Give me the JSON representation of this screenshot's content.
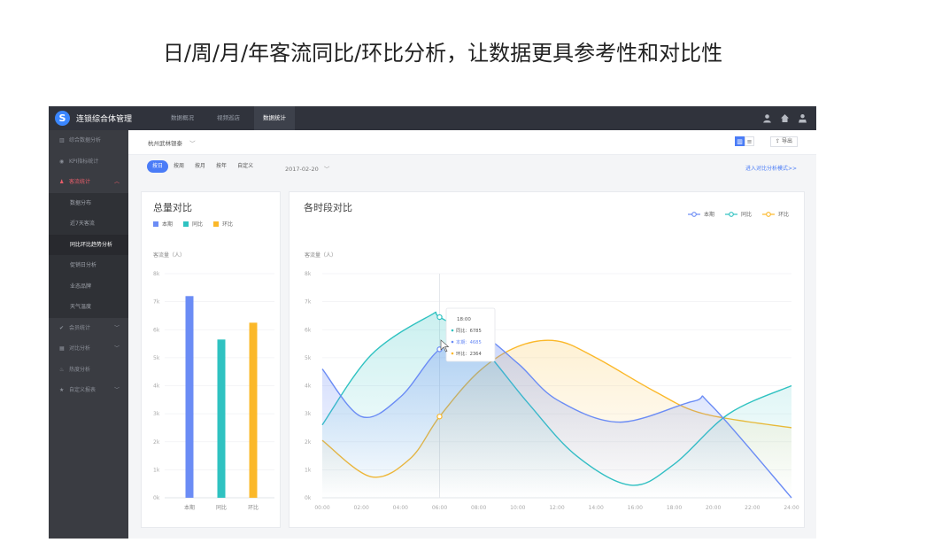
{
  "headline": "日/周/月/年客流同比/环比分析，让数据更具参考性和对比性",
  "app": {
    "logo_glyph": "S",
    "title": "连锁综合体管理",
    "topnav": [
      "数据概况",
      "视频巡店",
      "数据统计"
    ],
    "topnav_active": 2,
    "top_icons": [
      "user-icon",
      "home-icon",
      "download-icon"
    ]
  },
  "sidebar": {
    "items_top": [
      {
        "icon": "bar-chart-icon",
        "glyph": "▥",
        "label": "综合数据分析"
      },
      {
        "icon": "gauge-icon",
        "glyph": "◉",
        "label": "KPI指标统计"
      }
    ],
    "open_group": {
      "icon": "users-icon",
      "glyph": "♟",
      "label": "客流统计",
      "chevron": "︿"
    },
    "sub_items": [
      "数据分布",
      "近7天客流",
      "同比环比趋势分析",
      "促销日分析",
      "业态品牌",
      "天气温度"
    ],
    "sub_active": 2,
    "items_bottom": [
      {
        "icon": "check-icon",
        "glyph": "✔",
        "label": "会员统计",
        "chevron": "﹀"
      },
      {
        "icon": "calendar-icon",
        "glyph": "▦",
        "label": "对比分析",
        "chevron": "﹀"
      },
      {
        "icon": "fire-icon",
        "glyph": "♨",
        "label": "热度分析",
        "chevron": ""
      },
      {
        "icon": "star-icon",
        "glyph": "★",
        "label": "自定义报表",
        "chevron": "﹀"
      }
    ]
  },
  "filterbar": {
    "store": "杭州武林银泰",
    "store_chevron": "﹀",
    "view_chart_glyph": "▥",
    "view_list_glyph": "≡",
    "export_label": "⇪ 导出"
  },
  "periodbar": {
    "tabs": [
      "按日",
      "按周",
      "按月",
      "按年",
      "自定义"
    ],
    "active_tab": 0,
    "date": "2017-02-20",
    "date_chevron": "﹀",
    "compare_link": "进入对比分析模式>>"
  },
  "colors": {
    "current": "#6b8cf5",
    "yoy": "#2fc2c1",
    "mom": "#fbb829"
  },
  "chart_data": [
    {
      "type": "bar",
      "title": "总量对比",
      "ylabel": "客流量（人）",
      "categories": [
        "本期",
        "同比",
        "环比"
      ],
      "legend": [
        "本期",
        "同比",
        "环比"
      ],
      "values": [
        7200,
        5650,
        6250
      ],
      "yticks": [
        "0k",
        "1k",
        "2k",
        "3k",
        "4k",
        "5k",
        "6k",
        "7k",
        "8k"
      ],
      "ylim": [
        0,
        8000
      ]
    },
    {
      "type": "area",
      "title": "各时段对比",
      "ylabel": "客流量（人）",
      "x": [
        "00:00",
        "02:00",
        "04:00",
        "06:00",
        "08:00",
        "10:00",
        "12:00",
        "14:00",
        "16:00",
        "18:00",
        "20:00",
        "22:00",
        "24:00"
      ],
      "yticks": [
        "0k",
        "1k",
        "2k",
        "3k",
        "4k",
        "5k",
        "6k",
        "7k",
        "8k"
      ],
      "ylim": [
        0,
        8000
      ],
      "series": [
        {
          "name": "本期",
          "values": [
            4600,
            2900,
            3600,
            5300,
            5800,
            4800,
            3500,
            2700,
            3450,
            3300,
            null,
            null,
            0
          ],
          "hours": [
            0,
            2,
            4,
            6,
            8,
            10,
            12,
            15.2,
            19,
            19.9,
            null,
            null,
            24
          ]
        },
        {
          "name": "同比",
          "values": [
            2600,
            5100,
            6500,
            6450,
            5500,
            3400,
            1500,
            450,
            1200,
            3000,
            4000
          ],
          "hours": [
            0,
            2.5,
            5.5,
            6,
            8,
            10.5,
            13,
            15.8,
            18,
            20.8,
            24
          ]
        },
        {
          "name": "环比",
          "values": [
            2050,
            750,
            1400,
            2900,
            4500,
            5400,
            5600,
            5000,
            3800,
            3000,
            2500
          ],
          "hours": [
            0,
            2.5,
            4.5,
            6,
            8,
            10,
            12,
            14,
            17,
            19.5,
            24
          ]
        }
      ],
      "legend": [
        "本期",
        "同比",
        "环比"
      ],
      "tooltip": {
        "time": "18:00",
        "rows": [
          {
            "label": "同比：6785",
            "color": "yoy"
          },
          {
            "label": "本期：4685",
            "color": "current"
          },
          {
            "label": "环比：2364",
            "color": "mom"
          }
        ]
      }
    }
  ]
}
